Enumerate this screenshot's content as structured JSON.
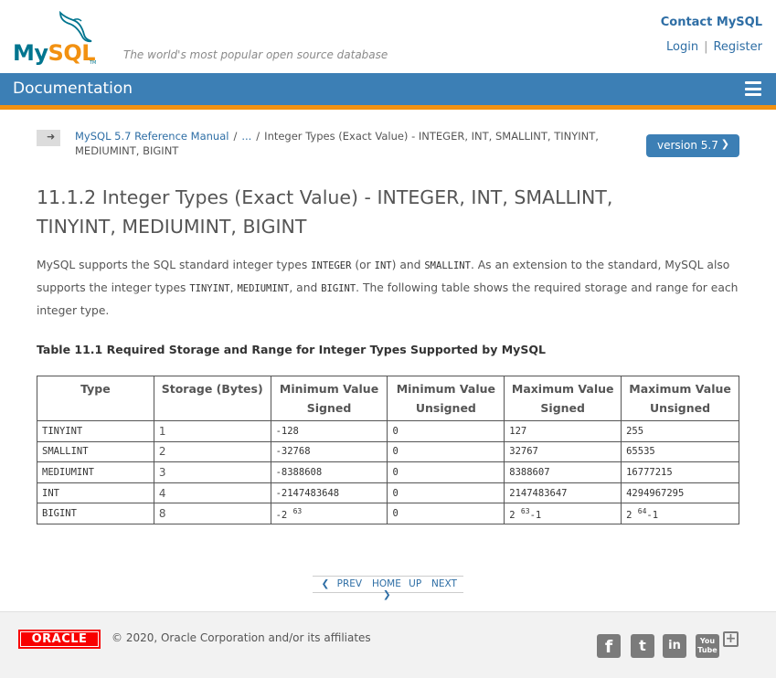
{
  "header": {
    "logo_my": "My",
    "logo_sql": "SQL",
    "logo_tm": "TM",
    "tagline": "The world's most popular open source database",
    "contact_label": "Contact MySQL",
    "login_label": "Login",
    "separator": "|",
    "register_label": "Register"
  },
  "docbar": {
    "title": "Documentation",
    "menu_icon": "hamburger-icon"
  },
  "breadcrumb": {
    "toggle_icon": "arrow-right-icon",
    "manual_link": "MySQL 5.7 Reference Manual",
    "sep": "/",
    "ellipsis_link": "...",
    "current": "Integer Types (Exact Value) - INTEGER, INT, SMALLINT, TINYINT, MEDIUMINT, BIGINT"
  },
  "version": {
    "label": "version 5.7",
    "icon": "chevron-down-icon"
  },
  "page": {
    "title": "11.1.2 Integer Types (Exact Value) - INTEGER, INT, SMALLINT, TINYINT, MEDIUMINT, BIGINT",
    "intro": {
      "t1": "MySQL supports the SQL standard integer types ",
      "c1": "INTEGER",
      "t2": " (or ",
      "c2": "INT",
      "t3": ") and ",
      "c3": "SMALLINT",
      "t4": ". As an extension to the standard, MySQL also supports the integer types ",
      "c4": "TINYINT",
      "t5": ", ",
      "c5": "MEDIUMINT",
      "t6": ", and ",
      "c6": "BIGINT",
      "t7": ". The following table shows the required storage and range for each integer type."
    },
    "table_caption": "Table 11.1 Required Storage and Range for Integer Types Supported by MySQL"
  },
  "table": {
    "headers": [
      {
        "line1": "Type",
        "line2": ""
      },
      {
        "line1": "Storage (Bytes)",
        "line2": ""
      },
      {
        "line1": "Minimum Value",
        "line2": "Signed"
      },
      {
        "line1": "Minimum Value",
        "line2": "Unsigned"
      },
      {
        "line1": "Maximum Value",
        "line2": "Signed"
      },
      {
        "line1": "Maximum Value",
        "line2": "Unsigned"
      }
    ],
    "rows": [
      {
        "type": "TINYINT",
        "storage": "1",
        "min_signed": "-128",
        "min_unsigned": "0",
        "max_signed": "127",
        "max_unsigned": "255"
      },
      {
        "type": "SMALLINT",
        "storage": "2",
        "min_signed": "-32768",
        "min_unsigned": "0",
        "max_signed": "32767",
        "max_unsigned": "65535"
      },
      {
        "type": "MEDIUMINT",
        "storage": "3",
        "min_signed": "-8388608",
        "min_unsigned": "0",
        "max_signed": "8388607",
        "max_unsigned": "16777215"
      },
      {
        "type": "INT",
        "storage": "4",
        "min_signed": "-2147483648",
        "min_unsigned": "0",
        "max_signed": "2147483647",
        "max_unsigned": "4294967295"
      }
    ],
    "bigint": {
      "type": "BIGINT",
      "storage": "8",
      "min_signed_base": "-2",
      "min_signed_exp": "63",
      "min_unsigned": "0",
      "max_signed_base": "2",
      "max_signed_exp": "63",
      "max_signed_tail": "-1",
      "max_unsigned_base": "2",
      "max_unsigned_exp": "64",
      "max_unsigned_tail": "-1"
    }
  },
  "pager": {
    "prev": "PREV",
    "home": "HOME",
    "up": "UP",
    "next": "NEXT"
  },
  "footer": {
    "oracle_logo": "ORACLE",
    "copyright": "© 2020, Oracle Corporation and/or its affiliates",
    "social_icons": [
      "facebook-icon",
      "twitter-icon",
      "linkedin-icon",
      "youtube-icon",
      "plus-icon"
    ],
    "facebook_glyph": "f",
    "twitter_glyph": "t",
    "linkedin_glyph": "in",
    "youtube_glyph_1": "You",
    "youtube_glyph_2": "Tube",
    "plus_glyph": "+"
  },
  "colors": {
    "docbar": "#3c7fb5",
    "accent_orange": "#f29111",
    "link": "#2e6ea5",
    "oracle_red": "#f80000"
  }
}
